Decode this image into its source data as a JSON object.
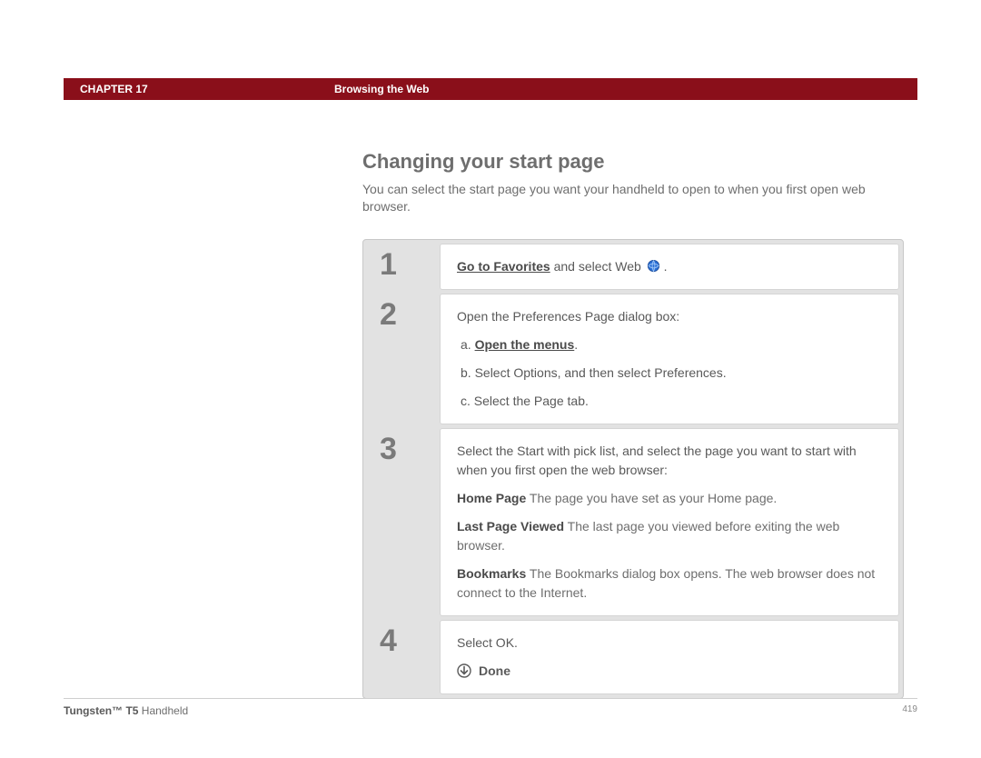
{
  "header": {
    "chapter_label": "CHAPTER 17",
    "chapter_title": "Browsing the Web"
  },
  "section": {
    "heading": "Changing your start page",
    "intro": "You can select the start page you want your handheld to open to when you first open web browser."
  },
  "steps": [
    {
      "num": "1",
      "line1_link": "Go to Favorites",
      "line1_rest": " and select Web ",
      "icon": "web-icon"
    },
    {
      "num": "2",
      "intro": "Open the Preferences Page dialog box:",
      "a_prefix": "a.  ",
      "a_link": "Open the menus",
      "a_suffix": ".",
      "b": "b.  Select Options, and then select Preferences.",
      "c": "c.  Select the Page tab."
    },
    {
      "num": "3",
      "intro": "Select the Start with pick list, and select the page you want to start with when you first open the web browser:",
      "opt1_term": "Home Page",
      "opt1_desc": "   The page you have set as your Home page.",
      "opt2_term": "Last Page Viewed",
      "opt2_desc": "   The last page you viewed before exiting the web browser.",
      "opt3_term": "Bookmarks",
      "opt3_desc": "   The Bookmarks dialog box opens. The web browser does not connect to the Internet."
    },
    {
      "num": "4",
      "line": "Select OK.",
      "done": "Done"
    }
  ],
  "footer": {
    "product_bold": "Tungsten™ T5",
    "product_rest": " Handheld",
    "page": "419"
  }
}
